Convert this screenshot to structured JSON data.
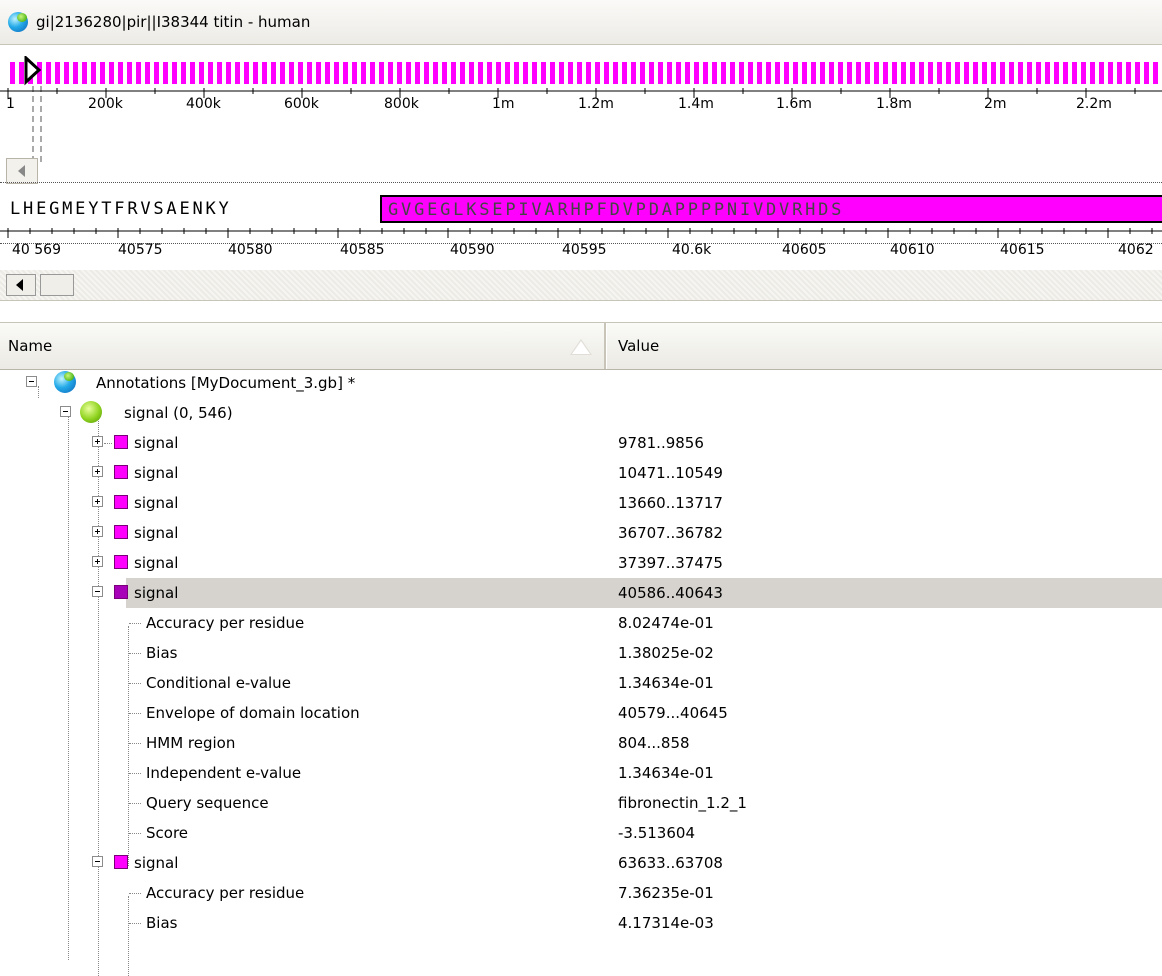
{
  "window": {
    "title": "gi|2136280|pir||I38344 titin - human"
  },
  "overview": {
    "ruler_labels": [
      "1",
      "200k",
      "400k",
      "600k",
      "800k",
      "1m",
      "1.2m",
      "1.4m",
      "1.6m",
      "1.8m",
      "2m",
      "2.2m"
    ],
    "accent": "#ff00ff"
  },
  "sequence": {
    "plain": "LHEGMEYTFRVSAENKY",
    "highlighted": "GVGEGLKSEPIVARHPFDVPDAPPPPNIVDVRHDS",
    "ruler_labels": [
      "40 569",
      "40575",
      "40580",
      "40585",
      "40590",
      "40595",
      "40.6k",
      "40605",
      "40610",
      "40615",
      "4062"
    ]
  },
  "tree": {
    "header": {
      "name": "Name",
      "value": "Value"
    },
    "root": {
      "label": "Annotations [MyDocument_3.gb] *"
    },
    "group": {
      "label": "signal  (0, 546)"
    },
    "rows": [
      {
        "label": "signal",
        "value": "9781..9856"
      },
      {
        "label": "signal",
        "value": "10471..10549"
      },
      {
        "label": "signal",
        "value": "13660..13717"
      },
      {
        "label": "signal",
        "value": "36707..36782"
      },
      {
        "label": "signal",
        "value": "37397..37475"
      },
      {
        "label": "signal",
        "value": "40586..40643"
      },
      {
        "label": "Accuracy per residue",
        "value": "8.02474e-01"
      },
      {
        "label": "Bias",
        "value": "1.38025e-02"
      },
      {
        "label": "Conditional e-value",
        "value": "1.34634e-01"
      },
      {
        "label": "Envelope of domain location",
        "value": "40579...40645"
      },
      {
        "label": "HMM region",
        "value": "804...858"
      },
      {
        "label": "Independent e-value",
        "value": "1.34634e-01"
      },
      {
        "label": "Query sequence",
        "value": "fibronectin_1.2_1"
      },
      {
        "label": "Score",
        "value": "-3.513604"
      },
      {
        "label": "signal",
        "value": "63633..63708"
      },
      {
        "label": "Accuracy per residue",
        "value": "7.36235e-01"
      },
      {
        "label": "Bias",
        "value": "4.17314e-03"
      }
    ]
  },
  "icons": {
    "document": "globe-icon",
    "group": "folder-icon",
    "annotation": "magenta-square-icon",
    "expand": "plus-box-icon",
    "collapse": "minus-box-icon"
  }
}
